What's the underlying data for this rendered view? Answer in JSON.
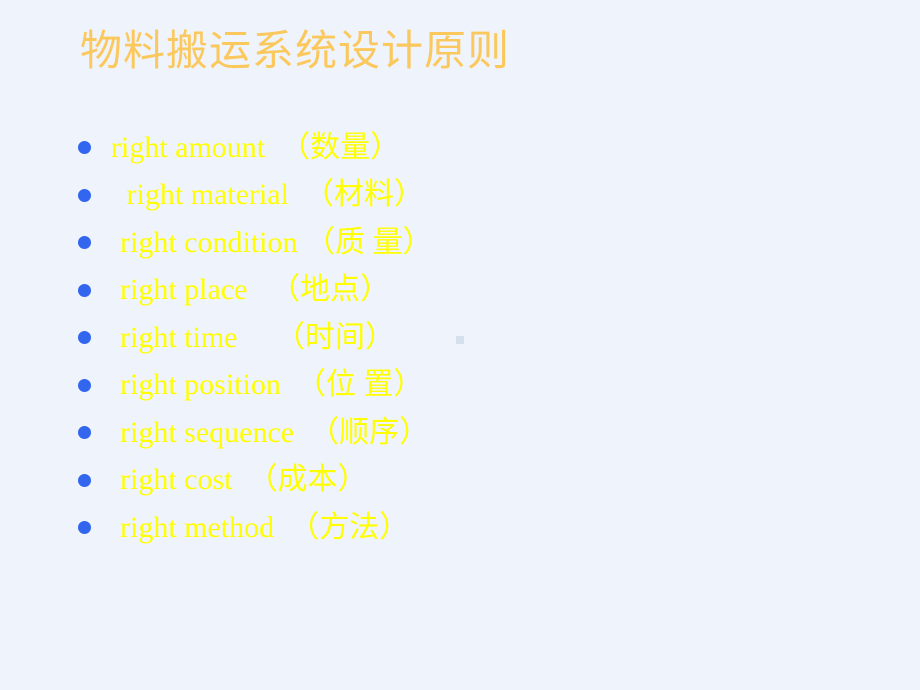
{
  "slide": {
    "background_color": "#eff4fc",
    "title": "物料搬运系统设计原则",
    "title_color": "#fbc85e",
    "bullet_color": "#3366ef",
    "text_color": "#ffff00",
    "items": [
      {
        "label": "right amount  （数量）"
      },
      {
        "label": " right material  （材料）"
      },
      {
        "label": "right condition （质 量）"
      },
      {
        "label": "right place   （地点）"
      },
      {
        "label": "right time     （时间）"
      },
      {
        "label": "right position  （位 置）"
      },
      {
        "label": "right sequence  （顺序）"
      },
      {
        "label": "right cost  （成本）"
      },
      {
        "label": "right method  （方法）"
      }
    ]
  }
}
